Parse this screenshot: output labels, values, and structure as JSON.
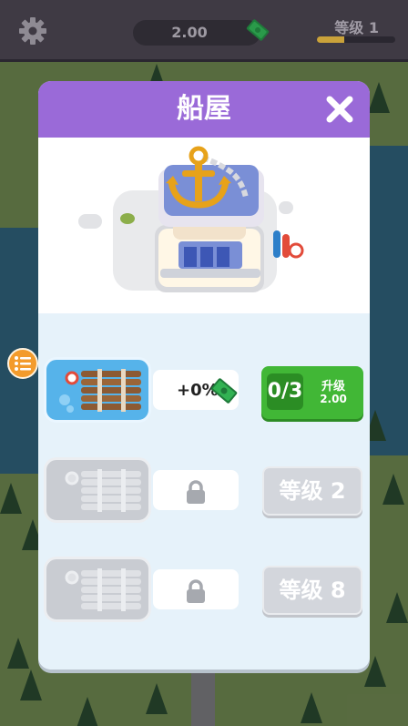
{
  "topbar": {
    "money": "2.00",
    "level": "等级 1",
    "xp_progress": 0.35
  },
  "dialog": {
    "title": "船屋",
    "rows": [
      {
        "state": "active",
        "bonus": "+0%",
        "count": "0/3",
        "upgrade_label": "升级",
        "upgrade_cost": "2.00"
      },
      {
        "state": "locked",
        "level_label": "等级 2"
      },
      {
        "state": "locked",
        "level_label": "等级 8"
      }
    ]
  },
  "colors": {
    "header_purple": "#9a6ad8",
    "upgrade_green": "#41b736",
    "list_button_orange": "#f39b2c"
  },
  "icons": [
    "gear-icon",
    "money-icon",
    "close-icon",
    "list-icon",
    "anchor-icon",
    "raft-icon",
    "cash-icon",
    "lock-icon"
  ]
}
